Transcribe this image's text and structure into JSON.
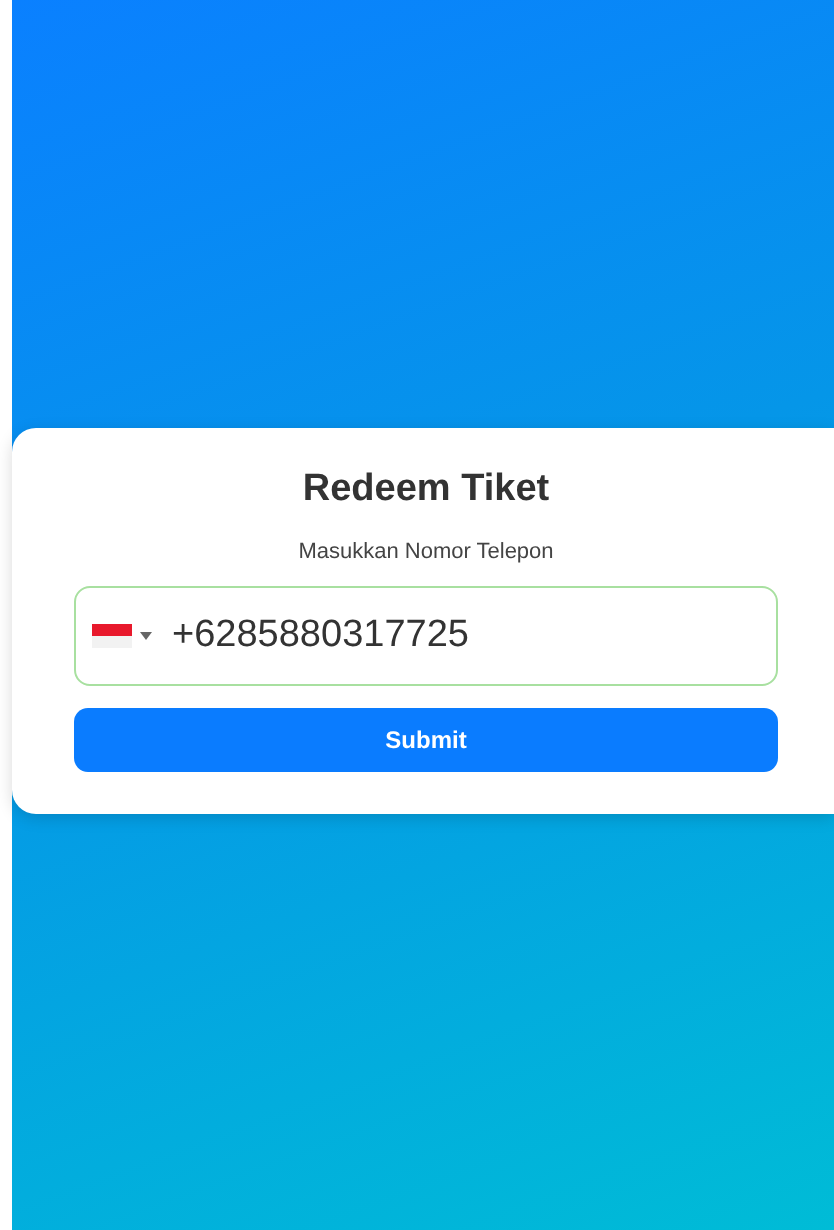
{
  "card": {
    "title": "Redeem Tiket",
    "label": "Masukkan Nomor Telepon"
  },
  "phone_field": {
    "value": "+6285880317725",
    "valid": true
  },
  "submit_button": {
    "label": "Submit"
  }
}
